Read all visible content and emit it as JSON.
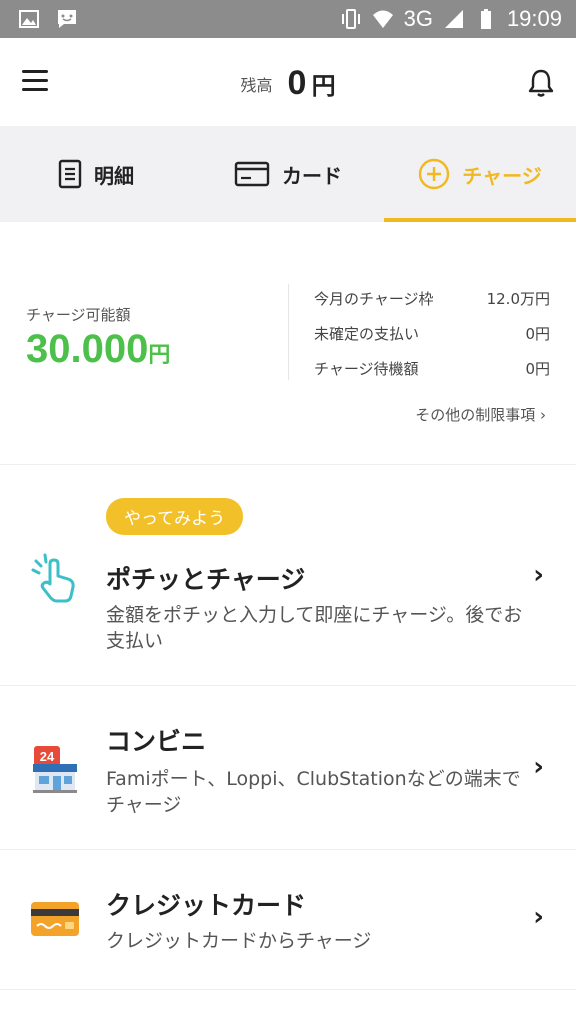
{
  "status_bar": {
    "time": "19:09",
    "network": "3G"
  },
  "header": {
    "balance_label": "残高",
    "balance_amount": "0",
    "balance_unit": "円"
  },
  "tabs": [
    {
      "label": "明細",
      "icon": "receipt-icon"
    },
    {
      "label": "カード",
      "icon": "card-icon"
    },
    {
      "label": "チャージ",
      "icon": "plus-circle-icon"
    }
  ],
  "active_tab": "チャージ",
  "limits": {
    "available_label": "チャージ可能額",
    "available_amount": "30.000",
    "available_unit": "円",
    "details": [
      {
        "label": "今月のチャージ枠",
        "value": "12.0万円"
      },
      {
        "label": "未確定の支払い",
        "value": "0円"
      },
      {
        "label": "チャージ待機額",
        "value": "0円"
      }
    ],
    "more_link": "その他の制限事項 ›"
  },
  "charge_options": [
    {
      "badge": "やってみよう",
      "title": "ポチッとチャージ",
      "desc": "金額をポチッと入力して即座にチャージ。後でお支払い",
      "icon": "tap-hand-icon"
    },
    {
      "title": "コンビニ",
      "desc": "Famiポート、Loppi、ClubStationなどの端末でチャージ",
      "icon": "convenience-store-icon"
    },
    {
      "title": "クレジットカード",
      "desc": "クレジットカードからチャージ",
      "icon": "credit-card-icon"
    }
  ],
  "chevron": "›",
  "colors": {
    "accent": "#f2b81f",
    "green": "#4cc04a",
    "tab_bg": "#f1f1f3",
    "status_bar": "#8c8c8c"
  }
}
